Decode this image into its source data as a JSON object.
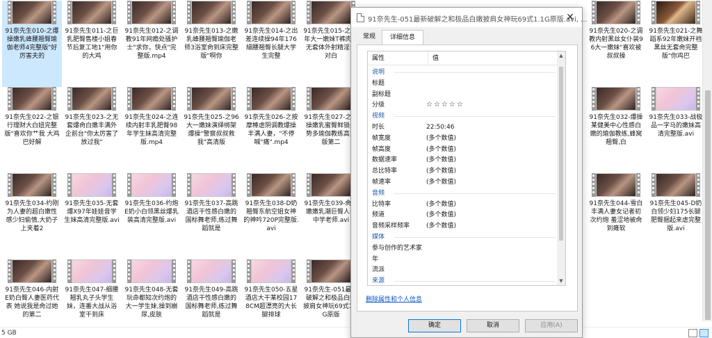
{
  "files": [
    {
      "name": "91奈先生010-之爆操嫩乳蜂腰翘臀瑜伽老师4完整版\"好厉害夫的",
      "selected": true,
      "scene": "dark"
    },
    {
      "name": "91奈先生011-之巨乳肥臀售楼小姐春节后复工地1\"用你的大鸡",
      "scene": "dark"
    },
    {
      "name": "91奈先生012-之调教91年网瘾处骚护士\"求你，快点\"完整版.mp4",
      "scene": "dark"
    },
    {
      "name": "91奈先生013-之嫩乳蜂腰翘臀瑜伽老师3浴室肏到床完整版\"啊你",
      "scene": "dark"
    },
    {
      "name": "91奈先生014-之出差连续操94年176細腰翘臀长腿大学生完整",
      "scene": "dark"
    },
    {
      "name": "91奈先生015-之96年大一嫩妹T裤肉丝无套体外射精淫语对白",
      "scene": "dark"
    },
    {
      "name": "91奈先生020-之调教内射黑丝女仆装96大一嫩妹\"喜欢被叔叔操",
      "scene": "dark"
    },
    {
      "name": "91奈先生021-之舞蹈系92年嫩妹开裆黑丝无套肏完整版\"你鸡巴",
      "scene": "warm"
    },
    {
      "name": "91奈先生022-之银行理财大白妞完整版\"喜欢你艹我 大鸡巴好解",
      "scene": "dark"
    },
    {
      "name": "91奈先生023-之无套爆肏白嫩丰满外企前台\"你太厉害了放过我\"",
      "scene": "dark"
    },
    {
      "name": "91奈先生024-之连续内射丰乳肥臀98年学生妹高清完整版.mp4",
      "scene": "dark"
    },
    {
      "name": "91奈先生025-之96大一嫩妹演绎绑架爆操\"警察叔叔救我\"高清版",
      "scene": "dark"
    },
    {
      "name": "91奈先生026-之按摩棒虐阴调教爆操丰满人妻，\"不停喊\"痛\".mp4",
      "scene": "dark"
    },
    {
      "name": "91奈先生027-之爆操嫩乳蜜臀鲜锁姿势多瑜伽教练高清版第二",
      "scene": "dark"
    },
    {
      "name": "91奈先生032-爆操某健美中心性感白嫩的瑜伽教练,蜂窝翘臀,白",
      "scene": "dark"
    },
    {
      "name": "91奈先生033-战极品一字马的嫩妹高清完整版.avi",
      "scene": "pastel"
    },
    {
      "name": "91奈先生034-约刚为人妻的超白嫩性感少妇偷情,大奶子上夹着2",
      "scene": "dark"
    },
    {
      "name": "91奈先生035-无套爆X97年娃娃音学生妹高清完整版.avi",
      "scene": "pastel"
    },
    {
      "name": "91奈先生036-约炮E奶小白领黑丝爆乳装高清完整版.avi",
      "scene": "pastel"
    },
    {
      "name": "91奈先生037-高跳酒店干性感白嫩的国标舞老师,练过舞蹈就是",
      "scene": "pastel"
    },
    {
      "name": "91奈先生038-D奶翘臀东航空姐女神的神吟720P完整版.avi",
      "scene": "dark"
    },
    {
      "name": "91奈先生039-肏白嫩嫩乳潮巨臀人妻中学老师.avi",
      "scene": "dark"
    },
    {
      "name": "91奈先生044-雪白丰满人妻女记者初次约炮 羞涩地被肏到瘫软",
      "scene": "dark"
    },
    {
      "name": "91奈先生045-D奶白领少妇175长腿肥臀捆起来虐完整版.avi",
      "scene": "dark"
    },
    {
      "name": "91奈先生046-内射E奶白臀人妻医药代表 她说我是肏过她的第二",
      "scene": "dark"
    },
    {
      "name": "91奈先生047-细腰翘乳丸子头学生妹，连番大战从浴室干到床",
      "scene": "pastel"
    },
    {
      "name": "91奈先生048-无套玩命都知次约炮的大一学生妹,操到崩尿,皮肤",
      "scene": "pastel"
    },
    {
      "name": "91奈先生049-高跳酒店干性感白嫩的国标舞老师,练过舞蹈就是",
      "scene": "pastel"
    },
    {
      "name": "91奈先生050-五星酒店大干某校园178CM超漂亮的大长腿排球",
      "scene": "pastel"
    },
    {
      "name": "91奈先生-051最新破解之和极品白嫩披肩女神玩69式1.1G原版",
      "scene": "dark"
    }
  ],
  "statusbar": {
    "size": "5 GB"
  },
  "dialog": {
    "title": "91奈先生-051最新破解之和极品白嫩披肩女神玩69式1.1G原版.avi, ...",
    "close": "✕",
    "tabs": [
      "常规",
      "详细信息"
    ],
    "header": {
      "property": "属性",
      "value": "值"
    },
    "rows": [
      {
        "k": "说明",
        "v": "",
        "group": true
      },
      {
        "k": "标题",
        "v": ""
      },
      {
        "k": "副标题",
        "v": ""
      },
      {
        "k": "分级",
        "v": "☆☆☆☆☆",
        "stars": true
      },
      {
        "k": "视频",
        "v": "",
        "group": true
      },
      {
        "k": "时长",
        "v": "22:50:46"
      },
      {
        "k": "帧宽度",
        "v": "(多个数值)"
      },
      {
        "k": "帧高度",
        "v": "(多个数值)"
      },
      {
        "k": "数据速率",
        "v": "(多个数值)"
      },
      {
        "k": "总比特率",
        "v": "(多个数值)"
      },
      {
        "k": "帧速率",
        "v": "(多个数值)"
      },
      {
        "k": "音频",
        "v": "",
        "group": true
      },
      {
        "k": "比特率",
        "v": "(多个数值)"
      },
      {
        "k": "频道",
        "v": "(多个数值)"
      },
      {
        "k": "音频采样频率",
        "v": "(多个数值)"
      },
      {
        "k": "媒体",
        "v": "",
        "group": true
      },
      {
        "k": "参与创作的艺术家",
        "v": ""
      },
      {
        "k": "年",
        "v": ""
      },
      {
        "k": "流派",
        "v": ""
      },
      {
        "k": "来源",
        "v": "",
        "group": true
      }
    ],
    "remove_link": "删除属性和个人信息",
    "buttons": {
      "ok": "确定",
      "cancel": "取消",
      "apply": "应用(A)"
    }
  }
}
